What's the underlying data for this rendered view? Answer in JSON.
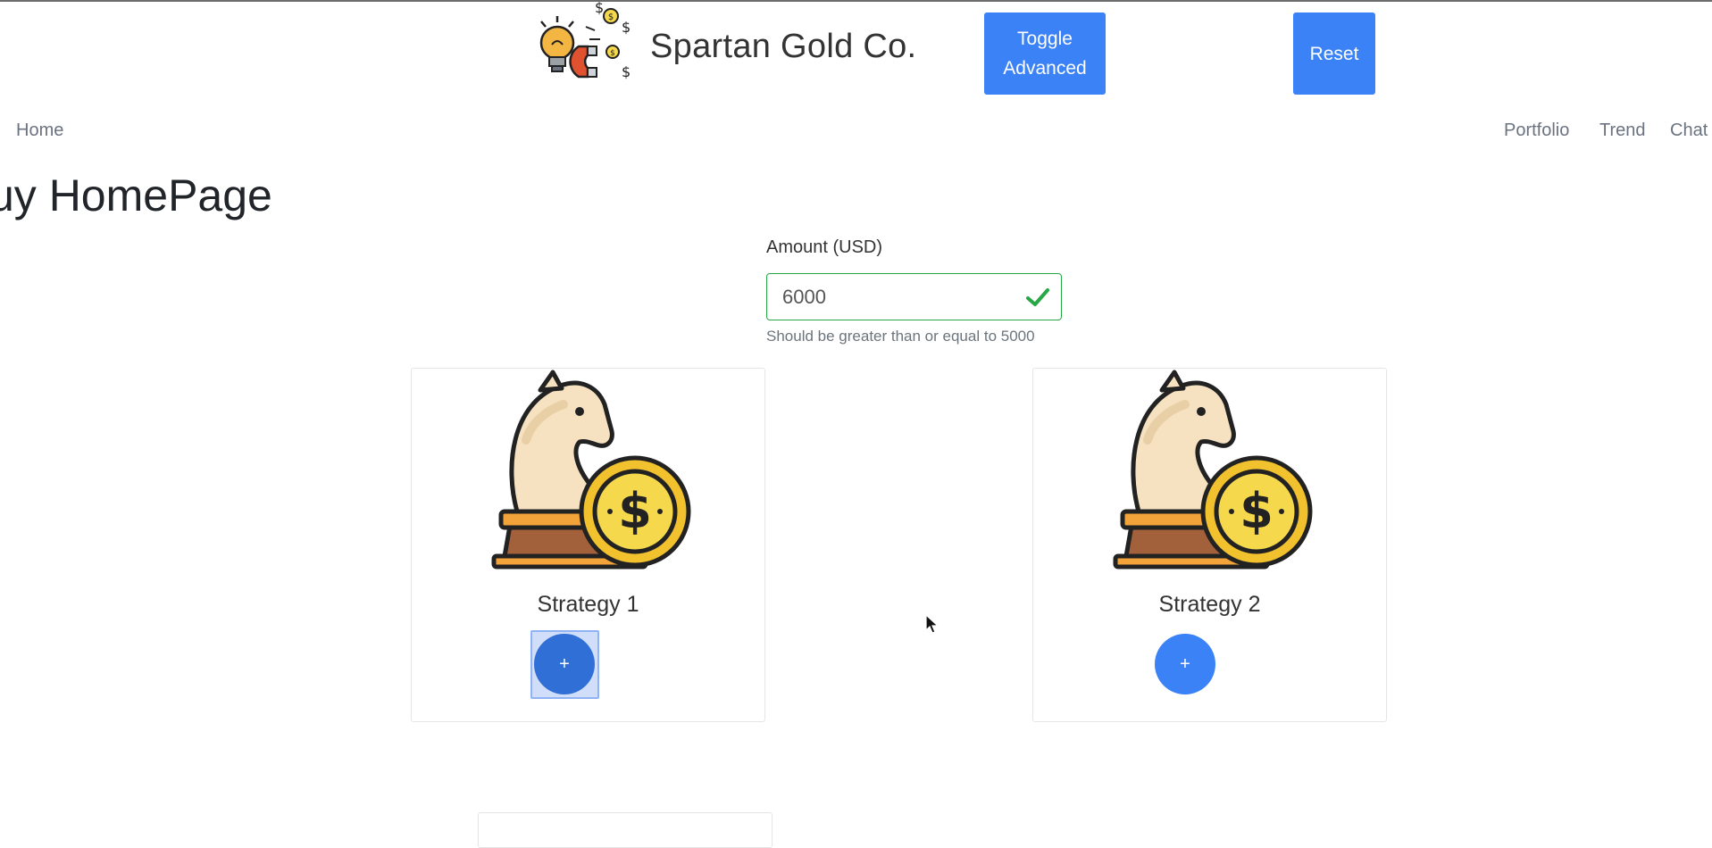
{
  "header": {
    "brand_name": "Spartan Gold Co.",
    "logo_icon": "lightbulb-magnet-coins-logo",
    "toggle_label": "Toggle Advanced",
    "reset_label": "Reset"
  },
  "nav": {
    "home": "Home",
    "portfolio": "Portfolio",
    "trend": "Trend",
    "chat": "Chat"
  },
  "page": {
    "title": "uy HomePage"
  },
  "amount": {
    "label": "Amount (USD)",
    "value": "6000",
    "help": "Should be greater than or equal to 5000",
    "valid": true
  },
  "strategies": [
    {
      "title": "Strategy 1",
      "icon": "knight-coin-icon",
      "add_label": "+"
    },
    {
      "title": "Strategy 2",
      "icon": "knight-coin-icon",
      "add_label": "+"
    }
  ],
  "colors": {
    "primary": "#3b82f6",
    "success": "#28a745",
    "gold": "#f6d84c"
  }
}
